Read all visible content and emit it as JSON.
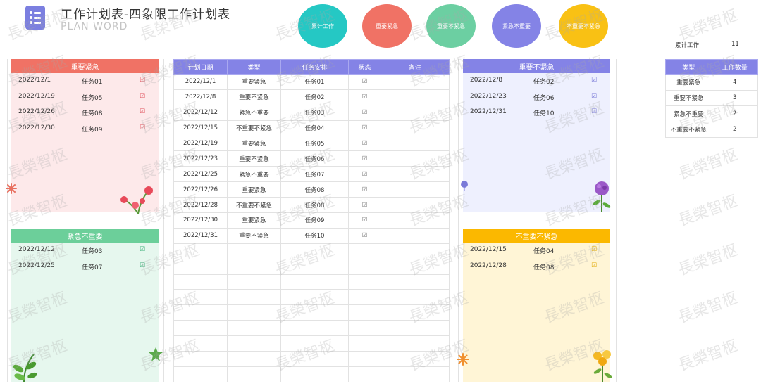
{
  "header": {
    "title": "工作计划表-四象限工作计划表",
    "subtitle": "PLAN WORD"
  },
  "nav_circles": [
    {
      "label": "累计工作"
    },
    {
      "label": "重要紧急"
    },
    {
      "label": "重要不紧急"
    },
    {
      "label": "紧急不重要"
    },
    {
      "label": "不重要不紧急"
    }
  ],
  "colors": {
    "urgent_important": "#f07265",
    "urgent_not_important": "#6ccf9a",
    "important_not_urgent": "#8483e6",
    "neither": "#fbb800",
    "accent": "#8483e6"
  },
  "quadrants": {
    "important_urgent": {
      "title": "重要紧急",
      "rows": [
        {
          "date": "2022/12/1",
          "task": "任务01",
          "check": "☑"
        },
        {
          "date": "2022/12/19",
          "task": "任务05",
          "check": "☑"
        },
        {
          "date": "2022/12/26",
          "task": "任务08",
          "check": "☑"
        },
        {
          "date": "2022/12/30",
          "task": "任务09",
          "check": "☑"
        }
      ]
    },
    "urgent_not_important": {
      "title": "紧急不重要",
      "rows": [
        {
          "date": "2022/12/12",
          "task": "任务03",
          "check": "☑"
        },
        {
          "date": "2022/12/25",
          "task": "任务07",
          "check": "☑"
        }
      ]
    },
    "important_not_urgent": {
      "title": "重要不紧急",
      "rows": [
        {
          "date": "2022/12/8",
          "task": "任务02",
          "check": "☑"
        },
        {
          "date": "2022/12/23",
          "task": "任务06",
          "check": "☑"
        },
        {
          "date": "2022/12/31",
          "task": "任务10",
          "check": "☑"
        }
      ]
    },
    "neither": {
      "title": "不重要不紧急",
      "rows": [
        {
          "date": "2022/12/15",
          "task": "任务04",
          "check": "☑"
        },
        {
          "date": "2022/12/28",
          "task": "任务08",
          "check": "☑"
        }
      ]
    }
  },
  "main_table": {
    "headers": [
      "计划日期",
      "类型",
      "任务安排",
      "状态",
      "备注"
    ],
    "rows": [
      {
        "date": "2022/12/1",
        "type": "重要紧急",
        "task": "任务01",
        "status": "☑",
        "note": ""
      },
      {
        "date": "2022/12/8",
        "type": "重要不紧急",
        "task": "任务02",
        "status": "☑",
        "note": ""
      },
      {
        "date": "2022/12/12",
        "type": "紧急不重要",
        "task": "任务03",
        "status": "☑",
        "note": ""
      },
      {
        "date": "2022/12/15",
        "type": "不重要不紧急",
        "task": "任务04",
        "status": "☑",
        "note": ""
      },
      {
        "date": "2022/12/19",
        "type": "重要紧急",
        "task": "任务05",
        "status": "☑",
        "note": ""
      },
      {
        "date": "2022/12/23",
        "type": "重要不紧急",
        "task": "任务06",
        "status": "☑",
        "note": ""
      },
      {
        "date": "2022/12/25",
        "type": "紧急不重要",
        "task": "任务07",
        "status": "☑",
        "note": ""
      },
      {
        "date": "2022/12/26",
        "type": "重要紧急",
        "task": "任务08",
        "status": "☑",
        "note": ""
      },
      {
        "date": "2022/12/28",
        "type": "不重要不紧急",
        "task": "任务08",
        "status": "☑",
        "note": ""
      },
      {
        "date": "2022/12/30",
        "type": "重要紧急",
        "task": "任务09",
        "status": "☑",
        "note": ""
      },
      {
        "date": "2022/12/31",
        "type": "重要不紧急",
        "task": "任务10",
        "status": "☑",
        "note": ""
      }
    ]
  },
  "stats": {
    "cumulative_label": "累计工作",
    "cumulative_value": "11",
    "headers": [
      "类型",
      "工作数量"
    ],
    "rows": [
      {
        "type": "重要紧急",
        "count": "4"
      },
      {
        "type": "重要不紧急",
        "count": "3"
      },
      {
        "type": "紧急不重要",
        "count": "2"
      },
      {
        "type": "不重要不紧急",
        "count": "2"
      }
    ]
  },
  "watermark": "長榮智枢"
}
